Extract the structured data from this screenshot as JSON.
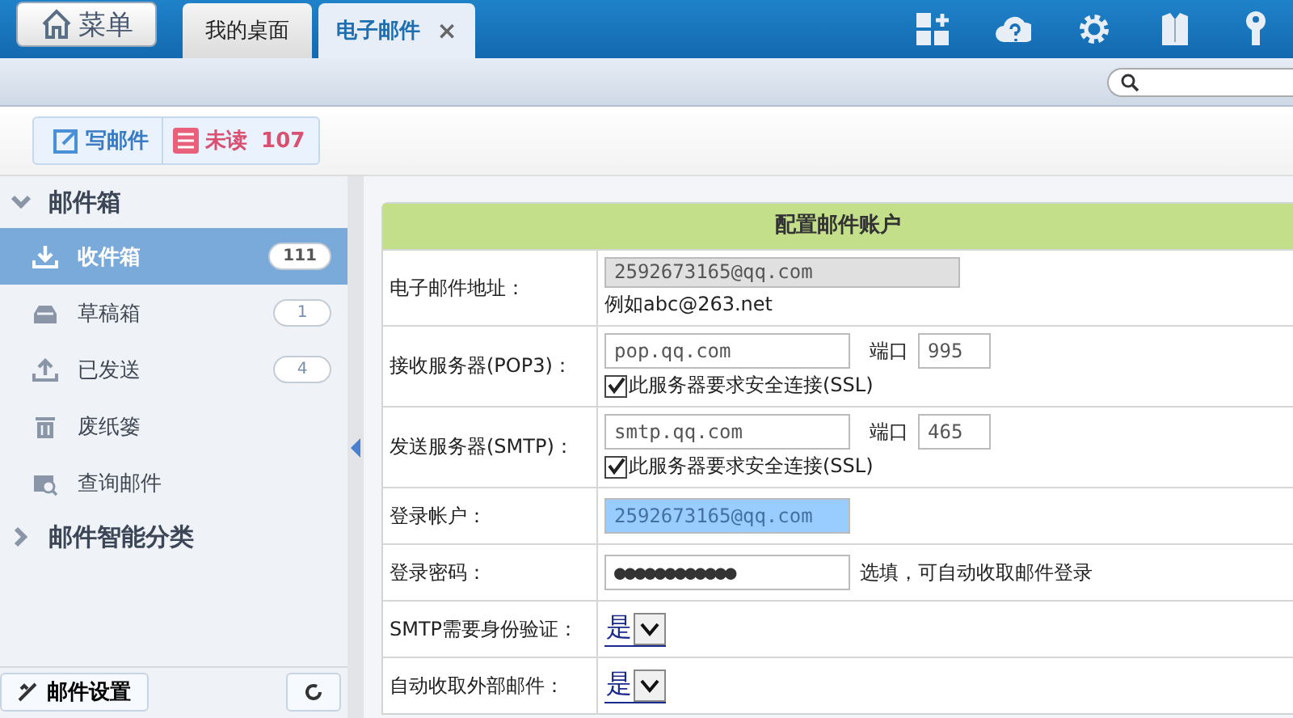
{
  "menu_button": {
    "label": "菜单"
  },
  "tabs": [
    {
      "label": "我的桌面",
      "selected": false
    },
    {
      "label": "电子邮件",
      "selected": true,
      "close_label": "×"
    }
  ],
  "header_icons": [
    {
      "kind": "add-widget"
    },
    {
      "kind": "help"
    },
    {
      "kind": "settings"
    },
    {
      "kind": "shirt"
    },
    {
      "kind": "key"
    }
  ],
  "toolbar": [
    {
      "kind": "compose",
      "label": "写邮件"
    },
    {
      "kind": "unread",
      "label": "未读",
      "count": "107"
    }
  ],
  "sidebar": {
    "groups": [
      {
        "label": "邮件箱",
        "expanded": true,
        "children": [
          {
            "kind": "inbox",
            "label": "收件箱",
            "count": "111",
            "selected": true
          },
          {
            "kind": "drafts",
            "label": "草稿箱",
            "count": "1",
            "selected": false
          },
          {
            "kind": "sent",
            "label": "已发送",
            "count": "4",
            "selected": false
          },
          {
            "kind": "trash",
            "label": "废纸篓",
            "selected": false
          },
          {
            "kind": "search",
            "label": "查询邮件",
            "selected": false
          }
        ]
      },
      {
        "label": "邮件智能分类",
        "expanded": false
      }
    ],
    "footer": {
      "label": "邮件设置"
    }
  },
  "form": {
    "title": "配置邮件账户",
    "rows": [
      {
        "kind": "text",
        "label": "电子邮件地址：",
        "value": "2592673165@qq.com",
        "disabled": true,
        "hint": "例如abc@263.net"
      },
      {
        "kind": "server",
        "label": "接收服务器(POP3)：",
        "value": "pop.qq.com",
        "port_label": "端口",
        "port": "995",
        "ssl_label": "此服务器要求安全连接(SSL)",
        "ssl_checked": true
      },
      {
        "kind": "server",
        "label": "发送服务器(SMTP)：",
        "value": "smtp.qq.com",
        "port_label": "端口",
        "port": "465",
        "ssl_label": "此服务器要求安全连接(SSL)",
        "ssl_checked": true
      },
      {
        "kind": "text",
        "label": "登录帐户：",
        "value": "2592673165@qq.com",
        "disabled": false,
        "highlighted": true
      },
      {
        "kind": "password",
        "label": "登录密码：",
        "value": "●●●●●●●●●●●●",
        "note": "选填，可自动收取邮件登录"
      },
      {
        "kind": "select",
        "label": "SMTP需要身份验证：",
        "value": "是"
      },
      {
        "kind": "select",
        "label": "自动收取外部邮件：",
        "value": "是"
      }
    ]
  }
}
